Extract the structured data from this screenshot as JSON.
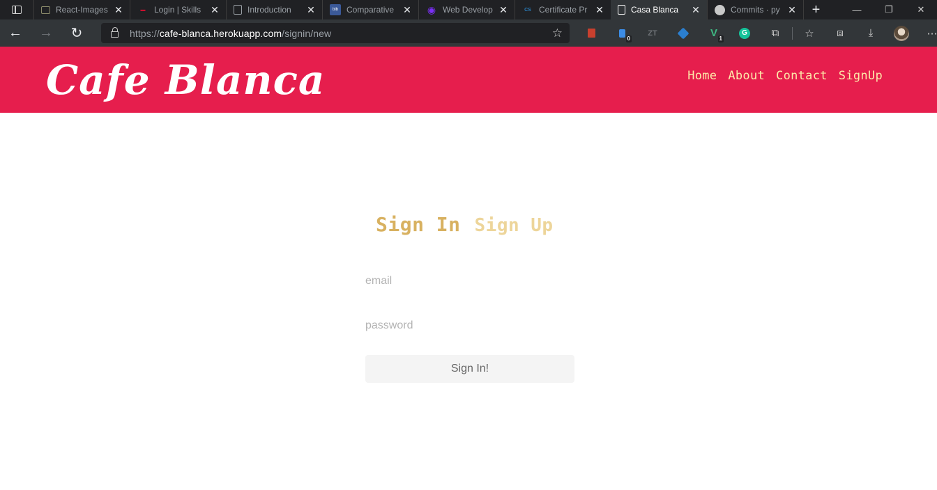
{
  "browser": {
    "tabs": [
      {
        "title": "React-Images",
        "active": false,
        "favicon": "image-stack-icon",
        "favicon_color": "#8a8a6a"
      },
      {
        "title": "Login | Skills",
        "active": false,
        "favicon": "skills-icon",
        "favicon_color": "#c8102e"
      },
      {
        "title": "Introduction",
        "active": false,
        "favicon": "document-icon",
        "favicon_color": "#9aa0a6"
      },
      {
        "title": "Comparative",
        "active": false,
        "favicon": "bib-icon",
        "favicon_color": "#3b5998"
      },
      {
        "title": "Web Develop",
        "active": false,
        "favicon": "eye-icon",
        "favicon_color": "#7b2ff7"
      },
      {
        "title": "Certificate Pr",
        "active": false,
        "favicon": "cs-edu-icon",
        "favicon_color": "#2a7fbf"
      },
      {
        "title": "Casa Blanca",
        "active": true,
        "favicon": "page-icon",
        "favicon_color": "#ffffff"
      },
      {
        "title": "Commits · py",
        "active": false,
        "favicon": "github-icon",
        "favicon_color": "#c8c8c8"
      }
    ],
    "address": {
      "scheme": "https://",
      "host": "cafe-blanca.herokuapp.com",
      "path": "/signin/new"
    },
    "extensions": [
      {
        "name": "bookmark-extension-icon",
        "badge": ""
      },
      {
        "name": "password-manager-icon",
        "badge": "0"
      },
      {
        "name": "zotero-icon",
        "badge": ""
      },
      {
        "name": "shield-extension-icon",
        "badge": ""
      },
      {
        "name": "vue-devtools-icon",
        "badge": "1"
      },
      {
        "name": "grammarly-icon",
        "badge": ""
      },
      {
        "name": "puzzle-extensions-icon",
        "badge": ""
      }
    ]
  },
  "site": {
    "logo": "Cafe Blanca",
    "nav": [
      "Home",
      "About",
      "Contact",
      "SignUp"
    ],
    "colors": {
      "header_bg": "#e61e4d",
      "nav_text": "#fde9a9",
      "accent_gold": "#d8b160"
    }
  },
  "auth": {
    "tab_signin": "Sign In",
    "tab_signup": "Sign Up",
    "email_placeholder": "email",
    "password_placeholder": "password",
    "submit_label": "Sign In!"
  }
}
